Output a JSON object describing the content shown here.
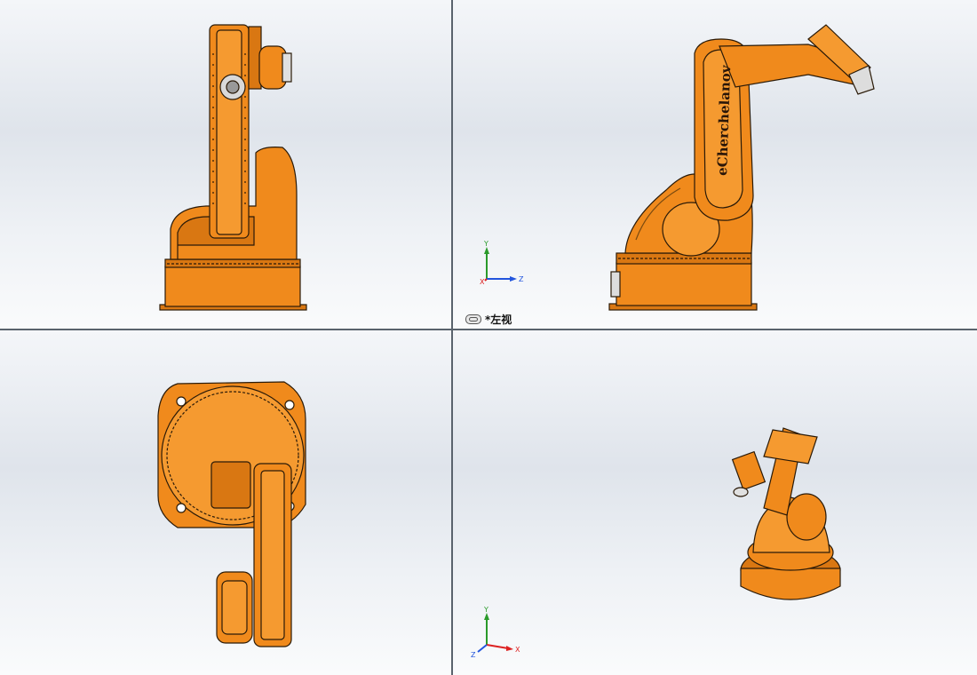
{
  "viewports": {
    "top_left": {
      "name": "front-view"
    },
    "top_right": {
      "name": "left-view",
      "view_label": "*左视",
      "robot_text": "eCherchelanov"
    },
    "bottom_left": {
      "name": "top-view"
    },
    "bottom_right": {
      "name": "isometric-view"
    }
  },
  "triad": {
    "x_label": "X",
    "y_label": "Y",
    "z_label": "Z"
  },
  "colors": {
    "robot_orange": "#f08a1c",
    "robot_dark": "#c96a0a",
    "outline": "#2a1a08",
    "axis_x": "#d22",
    "axis_y": "#2a9a2a",
    "axis_z": "#2255dd"
  }
}
